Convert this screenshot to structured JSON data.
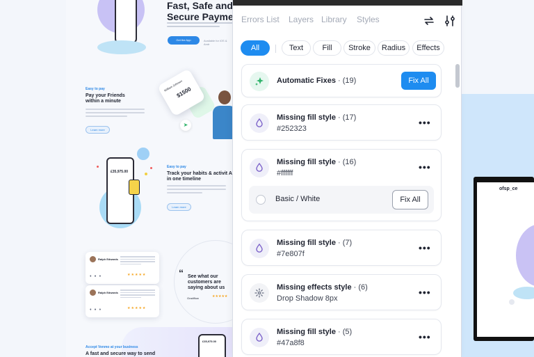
{
  "landing": {
    "hero_title": "Fast, Safe and Secure Paymen",
    "hero_button": "Get the App",
    "hero_note": "Available for iOS & Andr",
    "pay_kicker": "Easy to pay",
    "pay_title": "Pay your Friends within a minute",
    "pay_button": "Learn more",
    "card_name": "William Johnson",
    "card_amount": "$1500",
    "track_kicker": "Easy to pay",
    "track_title": "Track your habits & activit All in one timeline",
    "track_button": "Learn more",
    "phone_balance": "£35,975.00",
    "reviewer_1": "Ralph Edwards",
    "reviewer_2": "Ralph Edwards",
    "stars": "★★★★★",
    "quote_mark": "“",
    "see_what": "See what our customers are saying about us",
    "g2_label": "Gradiflow",
    "footer_kicker": "Accept Venmo at your business",
    "footer_title": "A fast and secure way to send",
    "footer_balance": "£35,975.00"
  },
  "frame_preview": {
    "logo": "ofsp_ce"
  },
  "panel": {
    "tabs": [
      {
        "label": "Errors List"
      },
      {
        "label": "Layers"
      },
      {
        "label": "Library"
      },
      {
        "label": "Styles"
      }
    ],
    "icons": {
      "refresh": "swap-arrows-icon",
      "settings": "sliders-icon"
    },
    "filters": [
      {
        "label": "All"
      },
      {
        "label": "Text"
      },
      {
        "label": "Fill"
      },
      {
        "label": "Stroke"
      },
      {
        "label": "Radius"
      },
      {
        "label": "Effects"
      }
    ],
    "automatic": {
      "title": "Automatic Fixes",
      "count": "· (19)",
      "button": "Fix All"
    },
    "errors": [
      {
        "title": "Missing fill style",
        "count": "· (17)",
        "value": "#252323"
      },
      {
        "title": "Missing fill style",
        "count": "· (16)",
        "value": "#ffffff",
        "suggestion": {
          "label": "Basic / White",
          "button": "Fix All"
        }
      },
      {
        "title": "Missing fill style",
        "count": "· (7)",
        "value": "#7e807f"
      },
      {
        "title": "Missing effects style",
        "count": "· (6)",
        "value": "Drop Shadow 8px"
      },
      {
        "title": "Missing fill style",
        "count": "· (5)",
        "value": "#47a8f8"
      }
    ],
    "more_glyph": "•••",
    "colors": {
      "accent": "#1e8cf0",
      "icon_purple": "#7b61c9",
      "icon_green": "#2fb36a"
    }
  }
}
